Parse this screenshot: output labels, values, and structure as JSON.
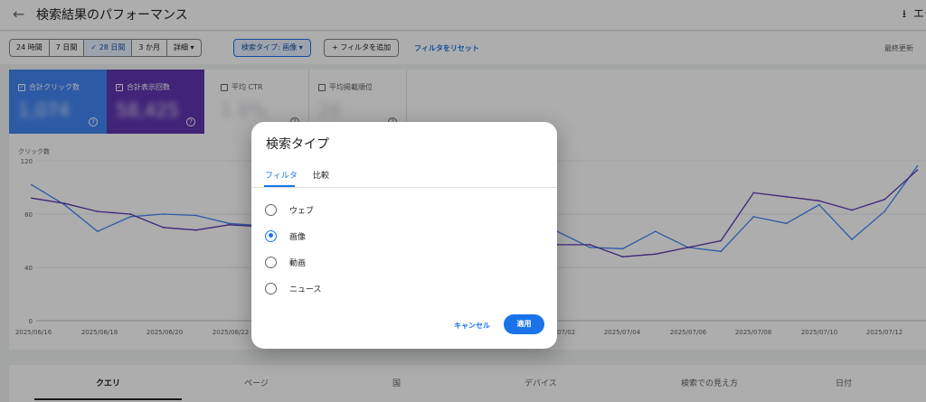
{
  "header": {
    "title": "検索結果のパフォーマンス",
    "export_label": "エクスポート",
    "icons": {
      "back": "arrow-back-icon",
      "export": "download-icon"
    }
  },
  "toolbar": {
    "date_ranges": [
      "24 時間",
      "7 日間",
      "28 日間",
      "3 か月",
      "詳細"
    ],
    "selected_range": "28 日間",
    "search_type_chip": "検索タイプ: 画像",
    "add_filter": "フィルタを追加",
    "reset_filters": "フィルタをリセット",
    "last_updated": "最終更新"
  },
  "metrics": [
    {
      "label": "合計クリック数",
      "value": "1,074",
      "checked": true
    },
    {
      "label": "合計表示回数",
      "value": "58,425",
      "checked": true
    },
    {
      "label": "平均 CTR",
      "value": "1.8%",
      "checked": false
    },
    {
      "label": "平均掲載順位",
      "value": "26",
      "checked": false
    }
  ],
  "chart_data": {
    "type": "line",
    "ylabel": "クリック数",
    "ylim": [
      0,
      120
    ],
    "yticks": [
      0,
      40,
      80,
      120
    ],
    "x_tick_labels": [
      "2025/06/16",
      "2025/06/18",
      "2025/06/20",
      "2025/06/22",
      "2025/07/02",
      "2025/07/04",
      "2025/07/06",
      "2025/07/08",
      "2025/07/10",
      "2025/07/12"
    ],
    "series": [
      {
        "color": "#4285f4",
        "x": [
          "2025/06/16",
          "2025/06/17",
          "2025/06/18",
          "2025/06/19",
          "2025/06/20",
          "2025/06/21",
          "2025/06/22",
          "2025/07/01",
          "2025/07/02",
          "2025/07/03",
          "2025/07/04",
          "2025/07/05",
          "2025/07/06",
          "2025/07/07",
          "2025/07/08",
          "2025/07/09",
          "2025/07/10",
          "2025/07/11",
          "2025/07/12",
          "2025/07/13"
        ],
        "values": [
          102,
          87,
          67,
          78,
          80,
          79,
          73,
          58,
          67,
          55,
          54,
          67,
          55,
          52,
          78,
          73,
          87,
          61,
          82,
          116
        ]
      },
      {
        "color": "#5e35b1",
        "x": [
          "2025/06/16",
          "2025/06/17",
          "2025/06/18",
          "2025/06/19",
          "2025/06/20",
          "2025/06/21",
          "2025/06/22",
          "2025/07/01",
          "2025/07/02",
          "2025/07/03",
          "2025/07/04",
          "2025/07/05",
          "2025/07/06",
          "2025/07/07",
          "2025/07/08",
          "2025/07/09",
          "2025/07/10",
          "2025/07/11",
          "2025/07/12",
          "2025/07/13"
        ],
        "values": [
          92,
          88,
          82,
          80,
          70,
          68,
          72,
          59,
          57,
          57,
          48,
          50,
          55,
          60,
          96,
          93,
          90,
          83,
          91,
          113
        ]
      }
    ]
  },
  "bottom_tabs": [
    "クエリ",
    "ページ",
    "国",
    "デバイス",
    "検索での見え方",
    "日付"
  ],
  "dialog": {
    "title": "検索タイプ",
    "tabs": [
      "フィルタ",
      "比較"
    ],
    "options": [
      "ウェブ",
      "画像",
      "動画",
      "ニュース"
    ],
    "selected_option": "画像",
    "cancel": "キャンセル",
    "apply": "適用"
  }
}
